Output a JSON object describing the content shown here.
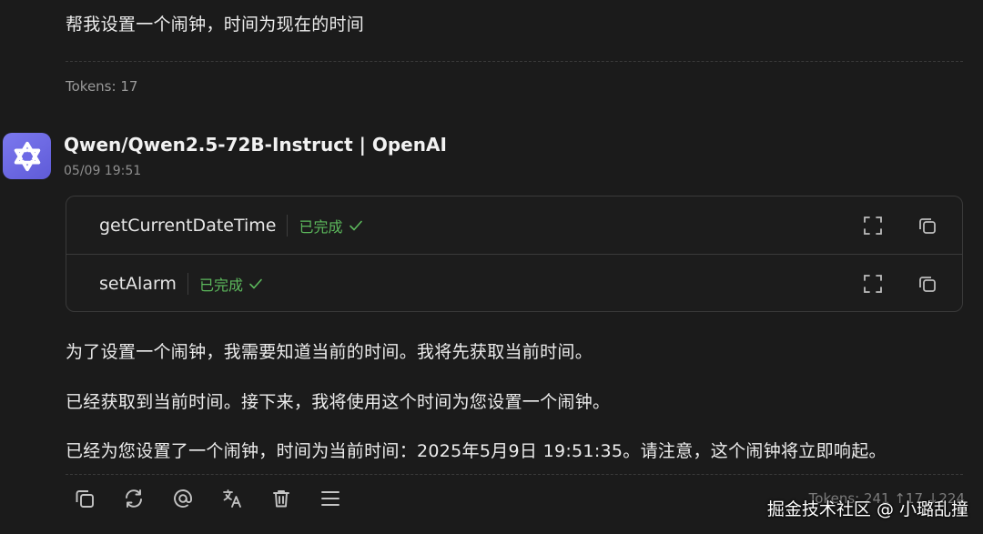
{
  "user_message": {
    "text": "帮我设置一个闹钟，时间为现在的时间",
    "tokens": "Tokens: 17"
  },
  "assistant": {
    "model_name": "Qwen/Qwen2.5-72B-Instruct | OpenAI",
    "timestamp": "05/09 19:51",
    "tool_calls": [
      {
        "name": "getCurrentDateTime",
        "status": "已完成"
      },
      {
        "name": "setAlarm",
        "status": "已完成"
      }
    ],
    "paragraphs": [
      "为了设置一个闹钟，我需要知道当前的时间。我将先获取当前时间。",
      "已经获取到当前时间。接下来，我将使用这个时间为您设置一个闹钟。",
      "已经为您设置了一个闹钟，时间为当前时间：2025年5月9日 19:51:35。请注意，这个闹钟将立即响起。"
    ],
    "tokens": "Tokens: 241 ↑17 ↓224",
    "toolbar_icons": [
      "copy-icon",
      "refresh-icon",
      "mention-icon",
      "translate-icon",
      "delete-icon",
      "menu-icon"
    ]
  },
  "watermark": "掘金技术社区 @ 小璐乱撞",
  "colors": {
    "background": "#1b1b1b",
    "status_green": "#5cb85c",
    "avatar": "#6e6ae6"
  }
}
